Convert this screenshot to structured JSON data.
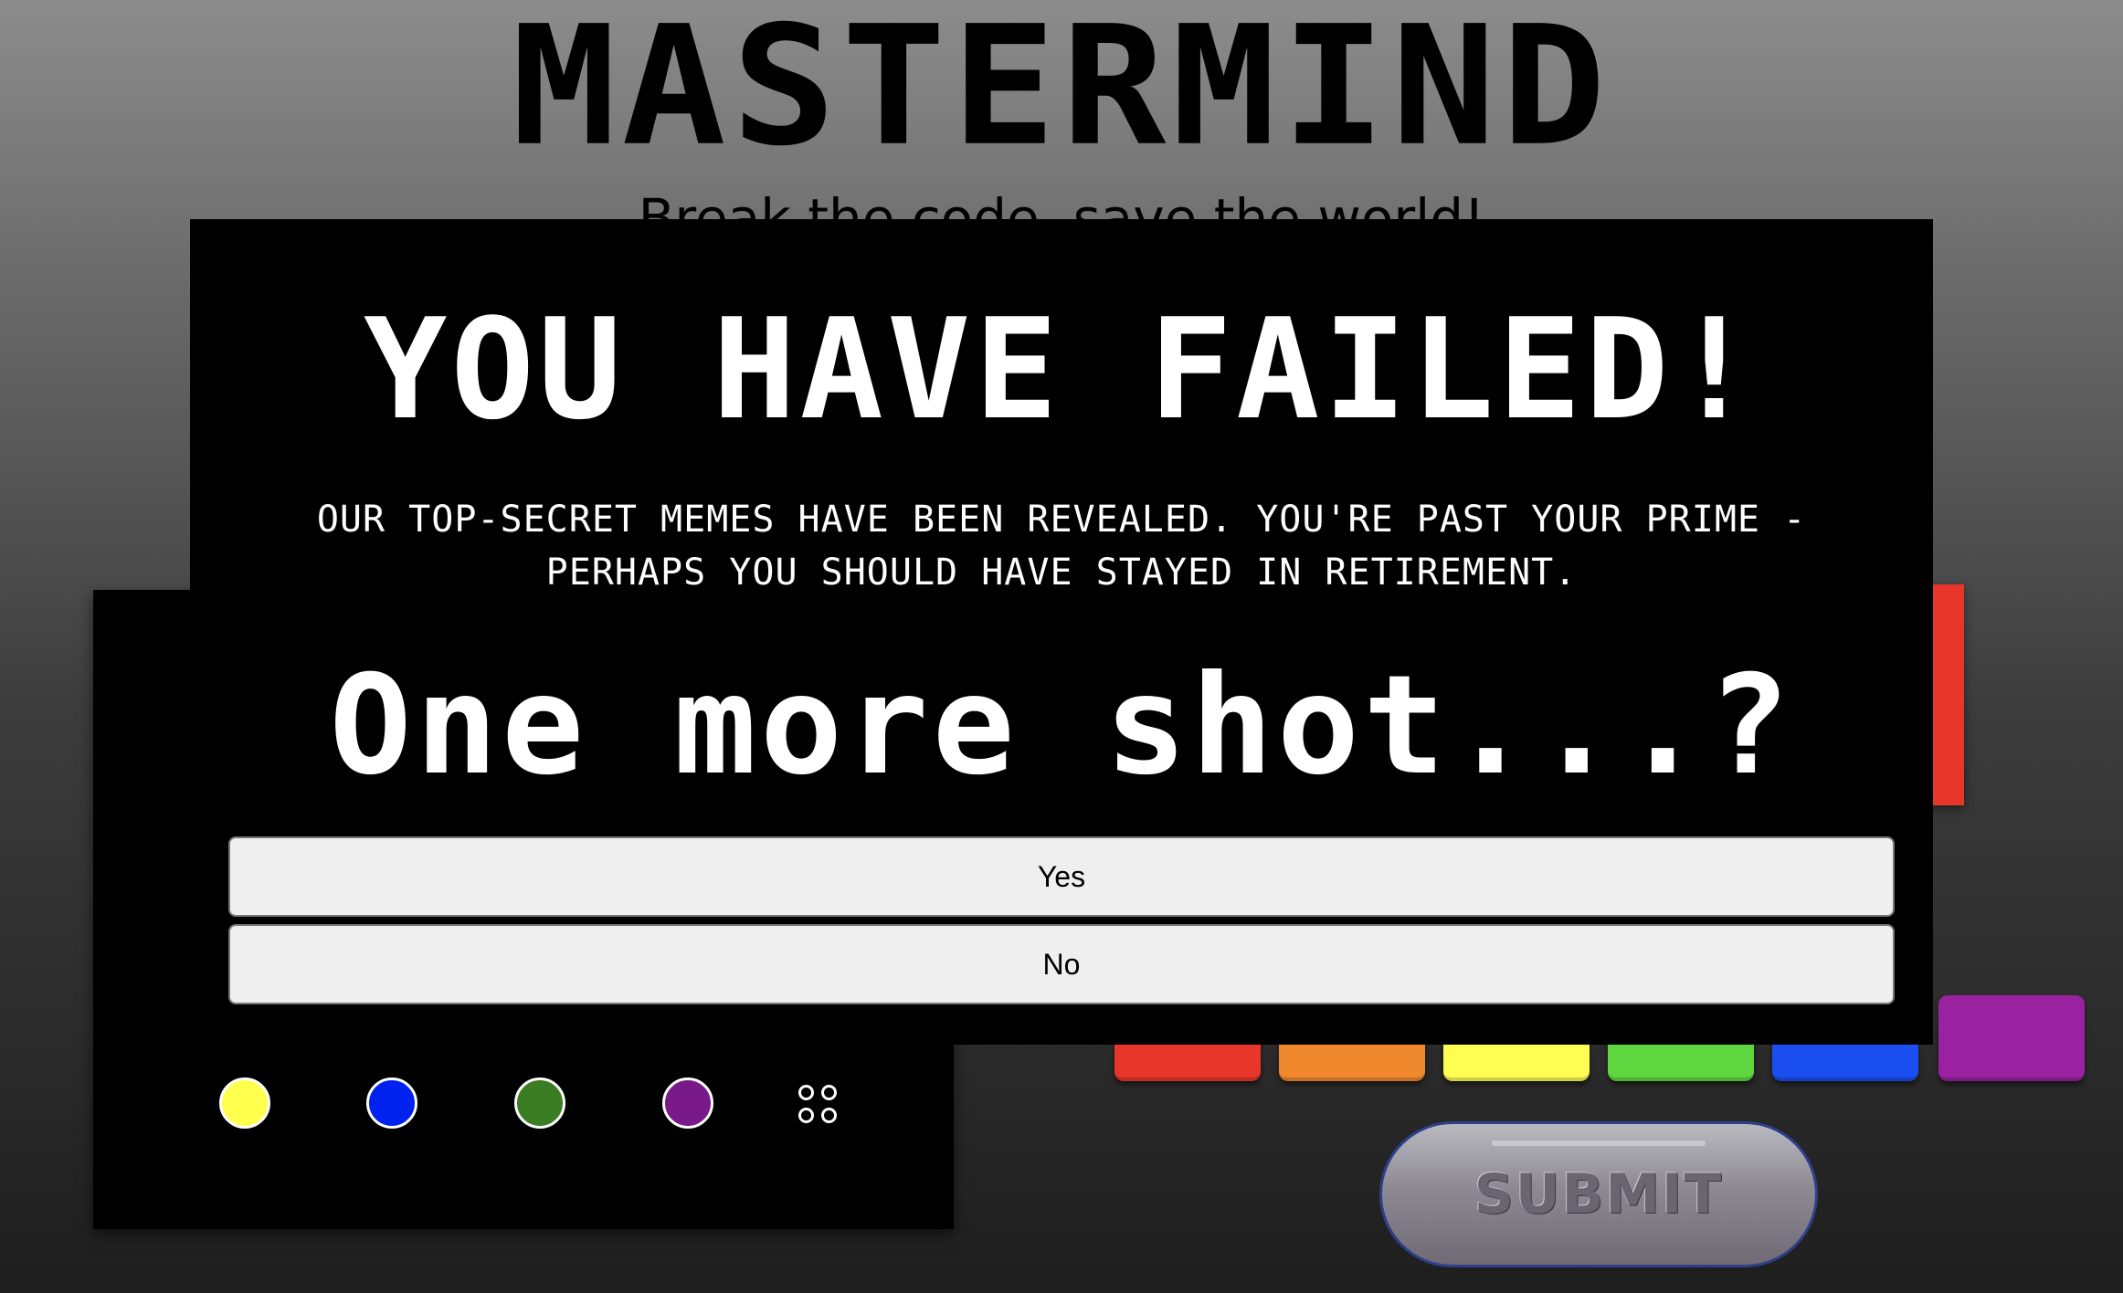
{
  "page": {
    "title": "MASTERMIND",
    "subtitle": "Break the code, save the world!"
  },
  "board": {
    "color_pegs": [
      {
        "name": "yellow",
        "color": "#ffff4d"
      },
      {
        "name": "blue",
        "color": "#0022ee"
      },
      {
        "name": "green",
        "color": "#3a7d22"
      },
      {
        "name": "purple",
        "color": "#7a1a8a"
      }
    ],
    "feedback_icon": "four-circles-icon",
    "secret_bar_color": "#e8362a"
  },
  "palette": {
    "colors": [
      {
        "name": "red",
        "color": "#e8362a"
      },
      {
        "name": "orange",
        "color": "#f0882e"
      },
      {
        "name": "yellow",
        "color": "#fdfd52"
      },
      {
        "name": "green",
        "color": "#5fd640"
      },
      {
        "name": "blue",
        "color": "#1a4ef0"
      },
      {
        "name": "purple",
        "color": "#9a22a0"
      }
    ]
  },
  "submit": {
    "label": "SUBMIT"
  },
  "modal": {
    "heading": "YOU HAVE FAILED!",
    "message": "OUR TOP-SECRET MEMES HAVE BEEN REVEALED. YOU'RE PAST YOUR PRIME - PERHAPS YOU SHOULD HAVE STAYED IN RETIREMENT.",
    "question": "One more shot...?",
    "yes_label": "Yes",
    "no_label": "No"
  }
}
